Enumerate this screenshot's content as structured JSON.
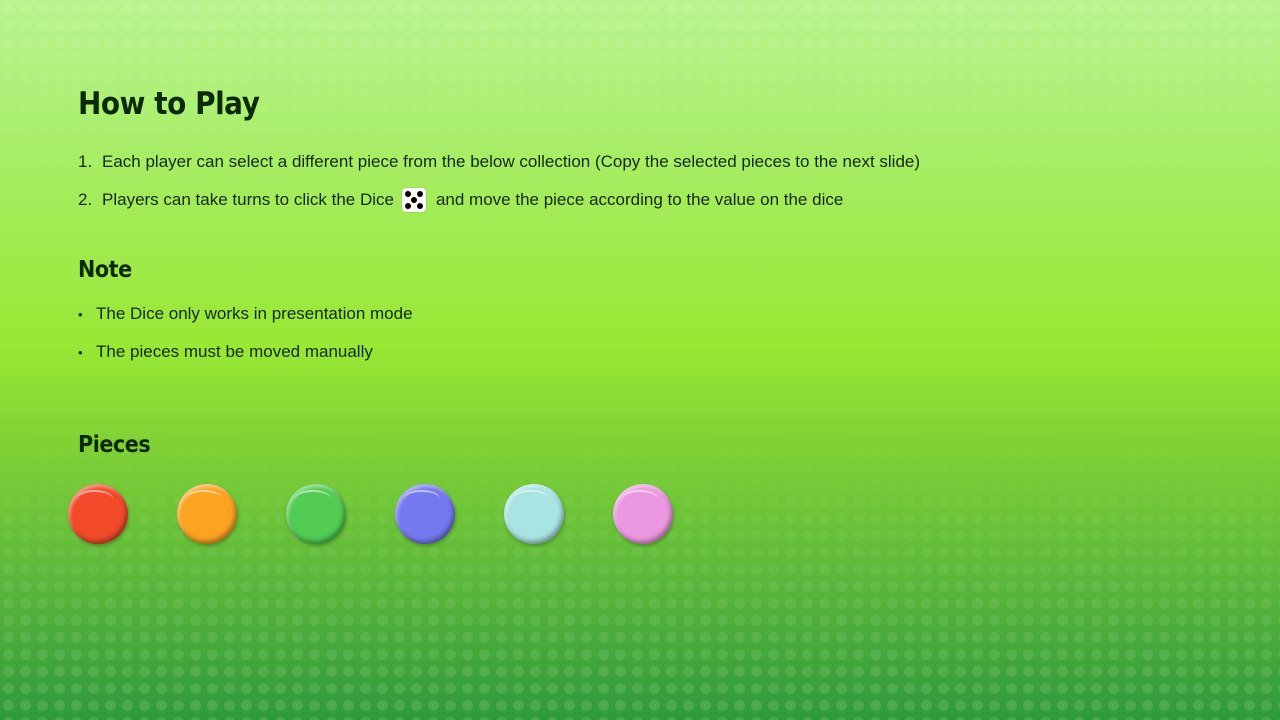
{
  "slide": {
    "title": "How to Play",
    "steps": [
      {
        "number": "1.",
        "text": "Each player can select a different piece from the below collection (Copy the selected pieces to the next slide)"
      },
      {
        "number": "2.",
        "text_before": "Players can take turns to click the Dice",
        "dice_icon": "dice-five-icon",
        "text_after": "and move the piece according to the value on the dice"
      }
    ],
    "note": {
      "heading": "Note",
      "bullet_symbol": "•",
      "items": [
        "The Dice only works in presentation mode",
        "The pieces must be moved manually"
      ]
    },
    "pieces": {
      "heading": "Pieces",
      "items": [
        {
          "name": "red",
          "color": "#f24a2a"
        },
        {
          "name": "orange",
          "color": "#fca321"
        },
        {
          "name": "green",
          "color": "#52cc52"
        },
        {
          "name": "blue",
          "color": "#7479f0"
        },
        {
          "name": "cyan",
          "color": "#a8e4e2"
        },
        {
          "name": "pink",
          "color": "#ec98e0"
        }
      ]
    }
  },
  "colors": {
    "background_top": "#b9f48e",
    "background_mid": "#98e834",
    "background_bottom": "#2f9a3a",
    "text": "#0c2a08"
  }
}
